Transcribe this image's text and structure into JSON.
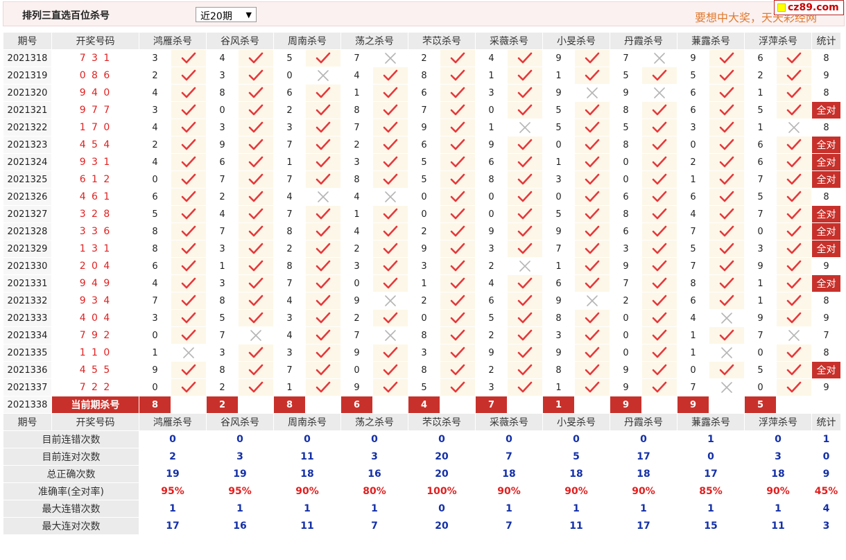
{
  "header": {
    "title": "排列三直选百位杀号",
    "period_select": "近20期",
    "slogan": "要想中大奖，天天彩经网",
    "logo_text": "cz89.com"
  },
  "columns": {
    "issue": "期号",
    "draw": "开奖号码",
    "experts": [
      "鸿雁杀号",
      "谷风杀号",
      "周南杀号",
      "荡之杀号",
      "芣苡杀号",
      "采薇杀号",
      "小旻杀号",
      "丹霞杀号",
      "蒹露杀号",
      "浮萍杀号"
    ],
    "stat": "统计"
  },
  "colors": {
    "correct": "#e5383b",
    "wrong": "#b5b5b5",
    "all_right_bg": "#c8312b"
  },
  "rows": [
    {
      "issue": "2021318",
      "draw": "7 3 1",
      "cells": [
        [
          3,
          1
        ],
        [
          4,
          1
        ],
        [
          5,
          1
        ],
        [
          7,
          0
        ],
        [
          2,
          1
        ],
        [
          4,
          1
        ],
        [
          9,
          1
        ],
        [
          7,
          0
        ],
        [
          9,
          1
        ],
        [
          6,
          1
        ]
      ],
      "stat": "8"
    },
    {
      "issue": "2021319",
      "draw": "0 8 6",
      "cells": [
        [
          2,
          1
        ],
        [
          3,
          1
        ],
        [
          0,
          0
        ],
        [
          4,
          1
        ],
        [
          8,
          1
        ],
        [
          1,
          1
        ],
        [
          1,
          1
        ],
        [
          5,
          1
        ],
        [
          5,
          1
        ],
        [
          2,
          1
        ]
      ],
      "stat": "9"
    },
    {
      "issue": "2021320",
      "draw": "9 4 0",
      "cells": [
        [
          4,
          1
        ],
        [
          8,
          1
        ],
        [
          6,
          1
        ],
        [
          1,
          1
        ],
        [
          6,
          1
        ],
        [
          3,
          1
        ],
        [
          9,
          0
        ],
        [
          9,
          0
        ],
        [
          6,
          1
        ],
        [
          1,
          1
        ]
      ],
      "stat": "8"
    },
    {
      "issue": "2021321",
      "draw": "9 7 7",
      "cells": [
        [
          3,
          1
        ],
        [
          0,
          1
        ],
        [
          2,
          1
        ],
        [
          8,
          1
        ],
        [
          7,
          1
        ],
        [
          0,
          1
        ],
        [
          5,
          1
        ],
        [
          8,
          1
        ],
        [
          6,
          1
        ],
        [
          5,
          1
        ]
      ],
      "stat": "全对"
    },
    {
      "issue": "2021322",
      "draw": "1 7 0",
      "cells": [
        [
          4,
          1
        ],
        [
          3,
          1
        ],
        [
          3,
          1
        ],
        [
          7,
          1
        ],
        [
          9,
          1
        ],
        [
          1,
          0
        ],
        [
          5,
          1
        ],
        [
          5,
          1
        ],
        [
          3,
          1
        ],
        [
          1,
          0
        ]
      ],
      "stat": "8"
    },
    {
      "issue": "2021323",
      "draw": "4 5 4",
      "cells": [
        [
          2,
          1
        ],
        [
          9,
          1
        ],
        [
          7,
          1
        ],
        [
          2,
          1
        ],
        [
          6,
          1
        ],
        [
          9,
          1
        ],
        [
          0,
          1
        ],
        [
          8,
          1
        ],
        [
          0,
          1
        ],
        [
          6,
          1
        ]
      ],
      "stat": "全对"
    },
    {
      "issue": "2021324",
      "draw": "9 3 1",
      "cells": [
        [
          4,
          1
        ],
        [
          6,
          1
        ],
        [
          1,
          1
        ],
        [
          3,
          1
        ],
        [
          5,
          1
        ],
        [
          6,
          1
        ],
        [
          1,
          1
        ],
        [
          0,
          1
        ],
        [
          2,
          1
        ],
        [
          6,
          1
        ]
      ],
      "stat": "全对"
    },
    {
      "issue": "2021325",
      "draw": "6 1 2",
      "cells": [
        [
          0,
          1
        ],
        [
          7,
          1
        ],
        [
          7,
          1
        ],
        [
          8,
          1
        ],
        [
          5,
          1
        ],
        [
          8,
          1
        ],
        [
          3,
          1
        ],
        [
          0,
          1
        ],
        [
          1,
          1
        ],
        [
          7,
          1
        ]
      ],
      "stat": "全对"
    },
    {
      "issue": "2021326",
      "draw": "4 6 1",
      "cells": [
        [
          6,
          1
        ],
        [
          2,
          1
        ],
        [
          4,
          0
        ],
        [
          4,
          0
        ],
        [
          0,
          1
        ],
        [
          0,
          1
        ],
        [
          0,
          1
        ],
        [
          6,
          1
        ],
        [
          6,
          1
        ],
        [
          5,
          1
        ]
      ],
      "stat": "8"
    },
    {
      "issue": "2021327",
      "draw": "3 2 8",
      "cells": [
        [
          5,
          1
        ],
        [
          4,
          1
        ],
        [
          7,
          1
        ],
        [
          1,
          1
        ],
        [
          0,
          1
        ],
        [
          0,
          1
        ],
        [
          5,
          1
        ],
        [
          8,
          1
        ],
        [
          4,
          1
        ],
        [
          7,
          1
        ]
      ],
      "stat": "全对"
    },
    {
      "issue": "2021328",
      "draw": "3 3 6",
      "cells": [
        [
          8,
          1
        ],
        [
          7,
          1
        ],
        [
          8,
          1
        ],
        [
          4,
          1
        ],
        [
          2,
          1
        ],
        [
          9,
          1
        ],
        [
          9,
          1
        ],
        [
          6,
          1
        ],
        [
          7,
          1
        ],
        [
          0,
          1
        ]
      ],
      "stat": "全对"
    },
    {
      "issue": "2021329",
      "draw": "1 3 1",
      "cells": [
        [
          8,
          1
        ],
        [
          3,
          1
        ],
        [
          2,
          1
        ],
        [
          2,
          1
        ],
        [
          9,
          1
        ],
        [
          3,
          1
        ],
        [
          7,
          1
        ],
        [
          3,
          1
        ],
        [
          5,
          1
        ],
        [
          3,
          1
        ]
      ],
      "stat": "全对"
    },
    {
      "issue": "2021330",
      "draw": "2 0 4",
      "cells": [
        [
          6,
          1
        ],
        [
          1,
          1
        ],
        [
          8,
          1
        ],
        [
          3,
          1
        ],
        [
          3,
          1
        ],
        [
          2,
          0
        ],
        [
          1,
          1
        ],
        [
          9,
          1
        ],
        [
          7,
          1
        ],
        [
          9,
          1
        ]
      ],
      "stat": "9"
    },
    {
      "issue": "2021331",
      "draw": "9 4 9",
      "cells": [
        [
          4,
          1
        ],
        [
          3,
          1
        ],
        [
          7,
          1
        ],
        [
          0,
          1
        ],
        [
          1,
          1
        ],
        [
          4,
          1
        ],
        [
          6,
          1
        ],
        [
          7,
          1
        ],
        [
          8,
          1
        ],
        [
          1,
          1
        ]
      ],
      "stat": "全对"
    },
    {
      "issue": "2021332",
      "draw": "9 3 4",
      "cells": [
        [
          7,
          1
        ],
        [
          8,
          1
        ],
        [
          4,
          1
        ],
        [
          9,
          0
        ],
        [
          2,
          1
        ],
        [
          6,
          1
        ],
        [
          9,
          0
        ],
        [
          2,
          1
        ],
        [
          6,
          1
        ],
        [
          1,
          1
        ]
      ],
      "stat": "8"
    },
    {
      "issue": "2021333",
      "draw": "4 0 4",
      "cells": [
        [
          3,
          1
        ],
        [
          5,
          1
        ],
        [
          3,
          1
        ],
        [
          2,
          1
        ],
        [
          0,
          1
        ],
        [
          5,
          1
        ],
        [
          8,
          1
        ],
        [
          0,
          1
        ],
        [
          4,
          0
        ],
        [
          9,
          1
        ]
      ],
      "stat": "9"
    },
    {
      "issue": "2021334",
      "draw": "7 9 2",
      "cells": [
        [
          0,
          1
        ],
        [
          7,
          0
        ],
        [
          4,
          1
        ],
        [
          7,
          0
        ],
        [
          8,
          1
        ],
        [
          2,
          1
        ],
        [
          3,
          1
        ],
        [
          0,
          1
        ],
        [
          1,
          1
        ],
        [
          7,
          0
        ]
      ],
      "stat": "7"
    },
    {
      "issue": "2021335",
      "draw": "1 1 0",
      "cells": [
        [
          1,
          0
        ],
        [
          3,
          1
        ],
        [
          3,
          1
        ],
        [
          9,
          1
        ],
        [
          3,
          1
        ],
        [
          9,
          1
        ],
        [
          9,
          1
        ],
        [
          0,
          1
        ],
        [
          1,
          0
        ],
        [
          0,
          1
        ]
      ],
      "stat": "8"
    },
    {
      "issue": "2021336",
      "draw": "4 5 5",
      "cells": [
        [
          9,
          1
        ],
        [
          8,
          1
        ],
        [
          7,
          1
        ],
        [
          0,
          1
        ],
        [
          8,
          1
        ],
        [
          2,
          1
        ],
        [
          8,
          1
        ],
        [
          9,
          1
        ],
        [
          0,
          1
        ],
        [
          5,
          1
        ]
      ],
      "stat": "全对"
    },
    {
      "issue": "2021337",
      "draw": "7 2 2",
      "cells": [
        [
          0,
          1
        ],
        [
          2,
          1
        ],
        [
          1,
          1
        ],
        [
          9,
          1
        ],
        [
          5,
          1
        ],
        [
          3,
          1
        ],
        [
          1,
          1
        ],
        [
          9,
          1
        ],
        [
          7,
          0
        ],
        [
          0,
          1
        ]
      ],
      "stat": "9"
    }
  ],
  "current": {
    "issue": "2021338",
    "label": "当前期杀号",
    "picks": [
      8,
      2,
      8,
      6,
      4,
      7,
      1,
      9,
      9,
      5
    ]
  },
  "summary": [
    {
      "label": "目前连错次数",
      "values": [
        "0",
        "0",
        "0",
        "0",
        "0",
        "0",
        "0",
        "0",
        "1",
        "0"
      ],
      "stat": "1",
      "style": "blue"
    },
    {
      "label": "目前连对次数",
      "values": [
        "2",
        "3",
        "11",
        "3",
        "20",
        "7",
        "5",
        "17",
        "0",
        "3"
      ],
      "stat": "0",
      "style": "blue"
    },
    {
      "label": "总正确次数",
      "values": [
        "19",
        "19",
        "18",
        "16",
        "20",
        "18",
        "18",
        "18",
        "17",
        "18"
      ],
      "stat": "9",
      "style": "blue"
    },
    {
      "label": "准确率(全对率)",
      "values": [
        "95%",
        "95%",
        "90%",
        "80%",
        "100%",
        "90%",
        "90%",
        "90%",
        "85%",
        "90%"
      ],
      "stat": "45%",
      "style": "red"
    },
    {
      "label": "最大连错次数",
      "values": [
        "1",
        "1",
        "1",
        "1",
        "0",
        "1",
        "1",
        "1",
        "1",
        "1"
      ],
      "stat": "4",
      "style": "blue"
    },
    {
      "label": "最大连对次数",
      "values": [
        "17",
        "16",
        "11",
        "7",
        "20",
        "7",
        "11",
        "17",
        "15",
        "11"
      ],
      "stat": "3",
      "style": "blue"
    }
  ]
}
